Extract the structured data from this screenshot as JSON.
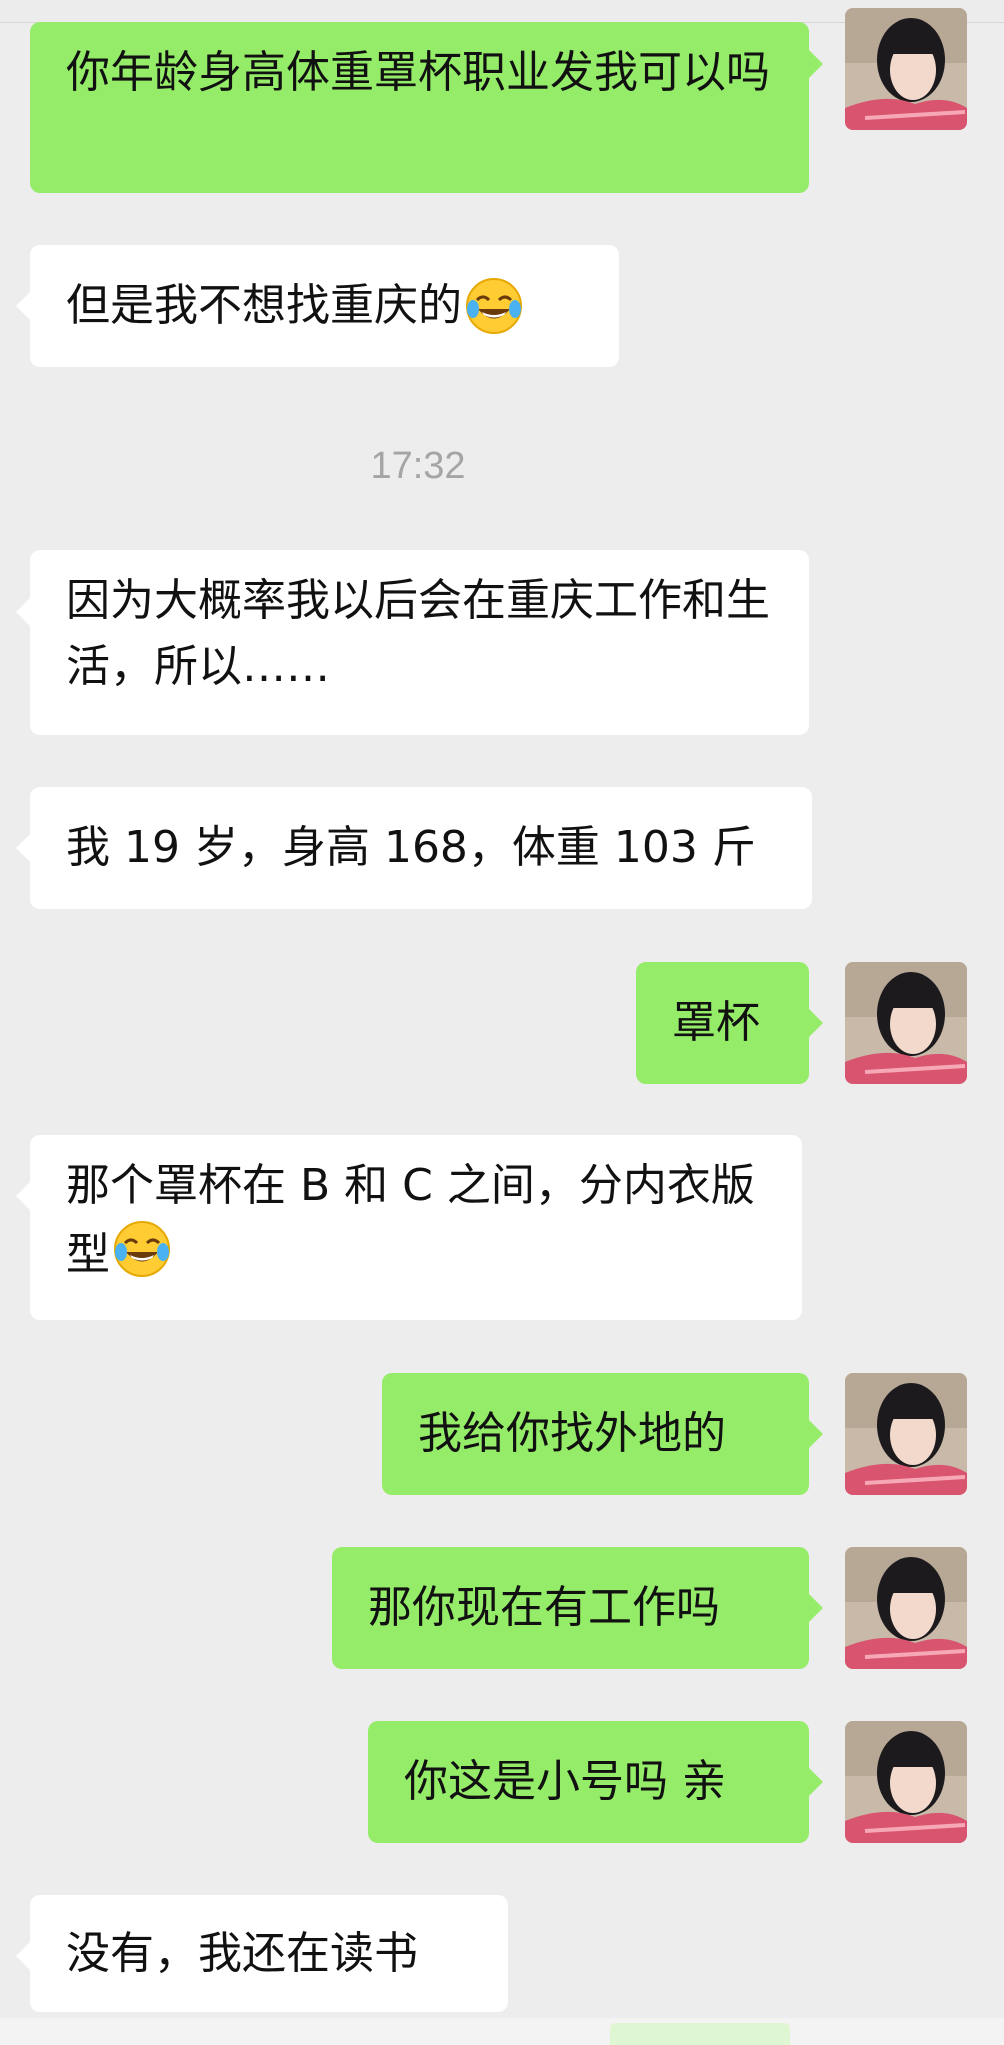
{
  "conversation": {
    "messages": [
      {
        "id": "m1",
        "from": "me",
        "text": "你年龄身高体重罩杯职业发我可以吗"
      },
      {
        "id": "m2",
        "from": "other",
        "text": "但是我不想找重庆的",
        "emoji": "tears-of-joy"
      },
      {
        "id": "m3",
        "from": "other",
        "text": "因为大概率我以后会在重庆工作和生活，所以……"
      },
      {
        "id": "m4",
        "from": "other",
        "text": "我 19 岁，身高 168，体重 103 斤"
      },
      {
        "id": "m5",
        "from": "me",
        "text": "罩杯"
      },
      {
        "id": "m6",
        "from": "other",
        "text": "那个罩杯在 B 和 C 之间，分内衣版型",
        "emoji": "tears-of-joy"
      },
      {
        "id": "m7",
        "from": "me",
        "text": "我给你找外地的"
      },
      {
        "id": "m8",
        "from": "me",
        "text": "那你现在有工作吗"
      },
      {
        "id": "m9",
        "from": "me",
        "text": "你这是小号吗 亲"
      },
      {
        "id": "m10",
        "from": "other",
        "text": "没有，我还在读书"
      }
    ],
    "timestamp": "17:32"
  },
  "colors": {
    "background": "#ededed",
    "my_bubble": "#95ec69",
    "other_bubble": "#ffffff",
    "timestamp": "#a5a5a5"
  },
  "icons": {
    "emoji": "face-with-tears-of-joy",
    "avatar": "user-avatar-photo"
  }
}
